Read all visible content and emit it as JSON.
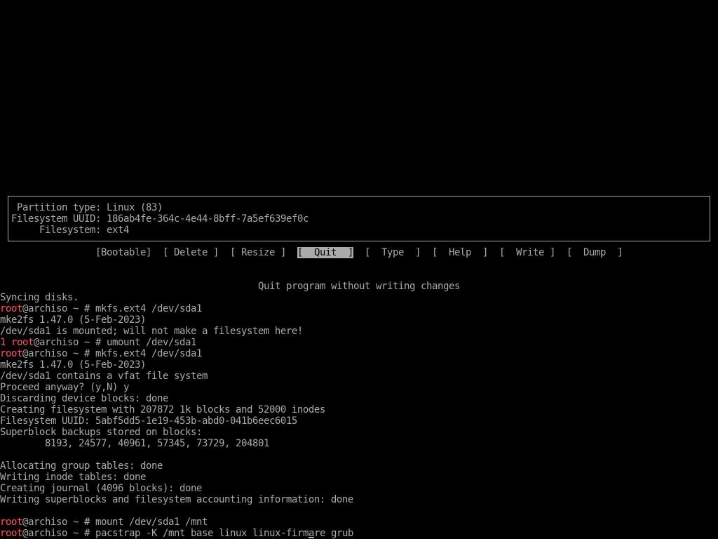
{
  "colors": {
    "background": "#000000",
    "text": "#aaaaaa",
    "prompt_user": "#ff5555",
    "selected_bg": "#aaaaaa",
    "selected_fg": "#000000"
  },
  "cfdisk": {
    "info": {
      "partition_type": {
        "label": "Partition type:",
        "value": "Linux (83)"
      },
      "filesystem_uuid": {
        "label": "Filesystem UUID:",
        "value": "186ab4fe-364c-4e44-8bff-7a5ef639ef0c"
      },
      "filesystem": {
        "label": "Filesystem:",
        "value": "ext4"
      }
    },
    "menu": [
      {
        "text": "[Bootable]",
        "selected": false
      },
      {
        "text": "[ Delete ]",
        "selected": false
      },
      {
        "text": "[ Resize ]",
        "selected": false
      },
      {
        "text": "[  Quit  ]",
        "selected": true
      },
      {
        "text": "[  Type  ]",
        "selected": false
      },
      {
        "text": "[  Help  ]",
        "selected": false
      },
      {
        "text": "[  Write ]",
        "selected": false
      },
      {
        "text": "[  Dump  ]",
        "selected": false
      }
    ],
    "hint": "Quit program without writing changes"
  },
  "shell": {
    "lines": [
      {
        "text": "Syncing disks."
      },
      {
        "user": "root",
        "prompt_tail": "@archiso ~ #",
        "command": "mkfs.ext4 /dev/sda1"
      },
      {
        "text": "mke2fs 1.47.0 (5-Feb-2023)"
      },
      {
        "text": "/dev/sda1 is mounted; will not make a filesystem here!"
      },
      {
        "status": "1",
        "user": "root",
        "prompt_tail": "@archiso ~ #",
        "command": "umount /dev/sda1"
      },
      {
        "user": "root",
        "prompt_tail": "@archiso ~ #",
        "command": "mkfs.ext4 /dev/sda1"
      },
      {
        "text": "mke2fs 1.47.0 (5-Feb-2023)"
      },
      {
        "text": "/dev/sda1 contains a vfat file system"
      },
      {
        "text": "Proceed anyway? (y,N) y"
      },
      {
        "text": "Discarding device blocks: done"
      },
      {
        "text": "Creating filesystem with 207872 1k blocks and 52000 inodes"
      },
      {
        "text": "Filesystem UUID: 5abf5dd5-1e19-453b-abd0-041b6eec6015"
      },
      {
        "text": "Superblock backups stored on blocks:"
      },
      {
        "text": "8193, 24577, 40961, 57345, 73729, 204801"
      },
      {
        "text": "Allocating group tables: done"
      },
      {
        "text": "Writing inode tables: done"
      },
      {
        "text": "Creating journal (4096 blocks): done"
      },
      {
        "text": "Writing superblocks and filesystem accounting information: done"
      },
      {
        "user": "root",
        "prompt_tail": "@archiso ~ #",
        "command": "mount /dev/sda1 /mnt"
      },
      {
        "user": "root",
        "prompt_tail": "@archiso ~ #",
        "command": "pacstrap -K /mnt base linux linux-firmare grub"
      }
    ]
  }
}
